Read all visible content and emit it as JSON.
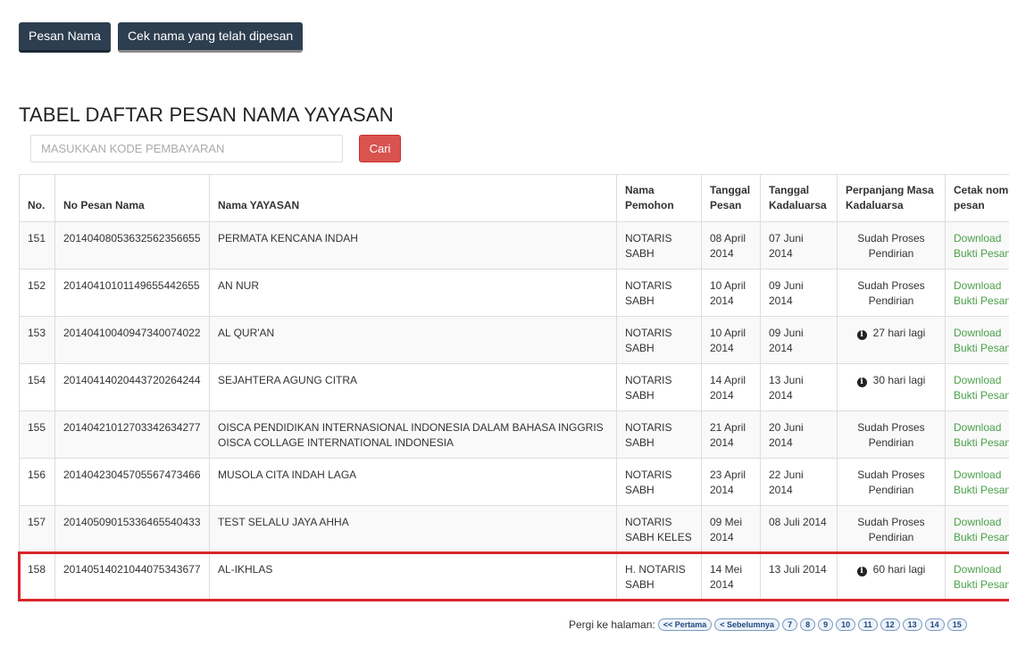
{
  "buttons": {
    "pesan_nama": "Pesan Nama",
    "cek_nama": "Cek nama yang telah dipesan"
  },
  "title": "TABEL DAFTAR PESAN NAMA YAYASAN",
  "search": {
    "placeholder": "MASUKKAN KODE PEMBAYARAN",
    "button": "Cari"
  },
  "table": {
    "headers": {
      "no": "No.",
      "no_pesan": "No Pesan Nama",
      "nama": "Nama YAYASAN",
      "pemohon": "Nama Pemohon",
      "tgl_pesan": "Tanggal Pesan",
      "tgl_kadaluarsa": "Tanggal Kadaluarsa",
      "perpanjang": "Perpanjang Masa Kadaluarsa",
      "cetak": "Cetak nomor pesan"
    },
    "rows": [
      {
        "no": "151",
        "no_pesan": "20140408053632562356655",
        "nama": "PERMATA KENCANA INDAH",
        "pemohon": "NOTARIS SABH",
        "tgl_pesan": "08 April 2014",
        "tgl_kadaluarsa": "07 Juni 2014",
        "perpanjang": "Sudah Proses Pendirian",
        "dl1": "Download",
        "dl2": "Bukti Pesan"
      },
      {
        "no": "152",
        "no_pesan": "20140410101149655442655",
        "nama": "AN NUR",
        "pemohon": "NOTARIS SABH",
        "tgl_pesan": "10 April 2014",
        "tgl_kadaluarsa": "09 Juni 2014",
        "perpanjang": "Sudah Proses Pendirian",
        "dl1": "Download",
        "dl2": "Bukti Pesan"
      },
      {
        "no": "153",
        "no_pesan": "20140410040947340074022",
        "nama": "AL QUR'AN",
        "pemohon": "NOTARIS SABH",
        "tgl_pesan": "10 April 2014",
        "tgl_kadaluarsa": "09 Juni 2014",
        "perpanjang": "27 hari lagi",
        "dl1": "Download",
        "dl2": "Bukti Pesan"
      },
      {
        "no": "154",
        "no_pesan": "20140414020443720264244",
        "nama": "SEJAHTERA AGUNG CITRA",
        "pemohon": "NOTARIS SABH",
        "tgl_pesan": "14 April 2014",
        "tgl_kadaluarsa": "13 Juni 2014",
        "perpanjang": "30 hari lagi",
        "dl1": "Download",
        "dl2": "Bukti Pesan"
      },
      {
        "no": "155",
        "no_pesan": "20140421012703342634277",
        "nama": "OISCA PENDIDIKAN INTERNASIONAL INDONESIA DALAM BAHASA INGGRIS OISCA COLLAGE INTERNATIONAL INDONESIA",
        "pemohon": "NOTARIS SABH",
        "tgl_pesan": "21 April 2014",
        "tgl_kadaluarsa": "20 Juni 2014",
        "perpanjang": "Sudah Proses Pendirian",
        "dl1": "Download",
        "dl2": "Bukti Pesan"
      },
      {
        "no": "156",
        "no_pesan": "20140423045705567473466",
        "nama": "MUSOLA CITA INDAH LAGA",
        "pemohon": "NOTARIS SABH",
        "tgl_pesan": "23 April 2014",
        "tgl_kadaluarsa": "22 Juni 2014",
        "perpanjang": "Sudah Proses Pendirian",
        "dl1": "Download",
        "dl2": "Bukti Pesan"
      },
      {
        "no": "157",
        "no_pesan": "20140509015336465540433",
        "nama": "TEST SELALU JAYA AHHA",
        "pemohon": "NOTARIS SABH KELES",
        "tgl_pesan": "09 Mei 2014",
        "tgl_kadaluarsa": "08 Juli 2014",
        "perpanjang": "Sudah Proses Pendirian",
        "dl1": "Download",
        "dl2": "Bukti Pesan"
      },
      {
        "no": "158",
        "no_pesan": "20140514021044075343677",
        "nama": "AL-IKHLAS",
        "pemohon": "H. NOTARIS SABH",
        "tgl_pesan": "14 Mei 2014",
        "tgl_kadaluarsa": "13 Juli 2014",
        "perpanjang": "60 hari lagi",
        "dl1": "Download",
        "dl2": "Bukti Pesan"
      }
    ]
  },
  "pager": {
    "label": "Pergi ke halaman:",
    "first": "<< Pertama",
    "prev": "< Sebelumnya",
    "pages": [
      "7",
      "8",
      "9",
      "10",
      "11",
      "12",
      "13",
      "14",
      "15"
    ]
  }
}
